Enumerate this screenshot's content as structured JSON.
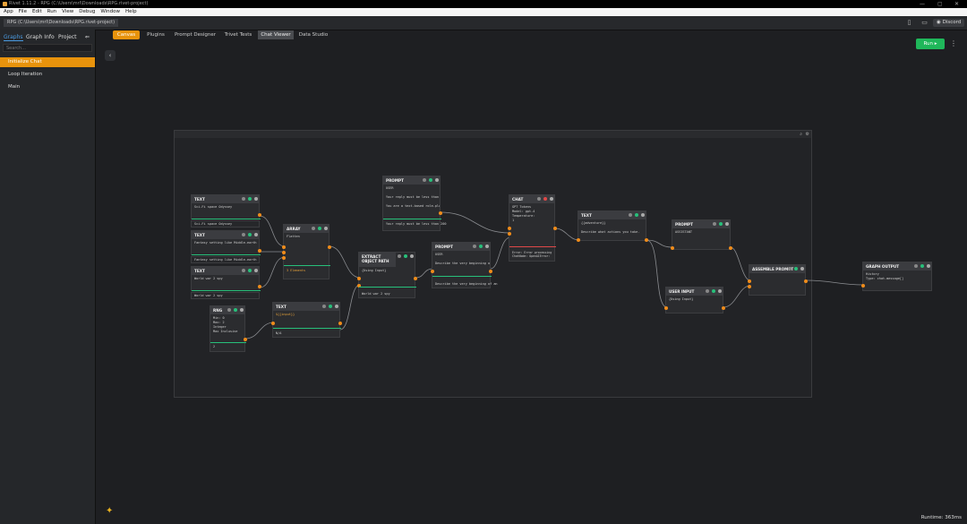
{
  "window": {
    "title": "Rivet 1.11.2 - RPG (C:\\Users\\mrl\\Downloads\\RPG.rivet-project)"
  },
  "menu": [
    "App",
    "File",
    "Edit",
    "Run",
    "View",
    "Debug",
    "Window",
    "Help"
  ],
  "project_tab": "RPG (C:\\Users\\mrl\\Downloads\\RPG.rivet-project)",
  "discord_label": "Discord",
  "sidebar": {
    "tabs": [
      "Graphs",
      "Graph Info",
      "Project"
    ],
    "search_placeholder": "Search...",
    "graphs": [
      "Initialize Chat",
      "Loop Iteration",
      "Main"
    ]
  },
  "top_tabs": [
    "Canvas",
    "Plugins",
    "Prompt Designer",
    "Trivet Tests",
    "Chat Viewer",
    "Data Studio"
  ],
  "run_label": "Run",
  "runtime": "Runtime: 363ms",
  "nodes": [
    {
      "title": "TEXT",
      "body": "Sci-Fi space Odyssey"
    },
    {
      "title": "TEXT",
      "body": "Fantasy setting like Middle-earth"
    },
    {
      "title": "TEXT",
      "body": "World war 2 spy"
    },
    {
      "title": "ARRAY",
      "body": "Flatten"
    },
    {
      "title": "RNG",
      "body": "Min: 0\nMax: 2\nInteger\nMax Inclusive"
    },
    {
      "title": "TEXT",
      "body": "${{input}}"
    },
    {
      "title": "PROMPT",
      "body": "USER\n\nYour reply must be less than 200 w\n\nYou are a text-based role-playing"
    },
    {
      "title": "EXTRACT OBJECT PATH",
      "body": "{Using Input}"
    },
    {
      "title": "PROMPT",
      "body": "USER\n\nDescribe the very beginning of an"
    },
    {
      "title": "CHAT",
      "body": "GPT Tokens\nModel: gpt-4\nTemperature:\n1"
    },
    {
      "title": "TEXT",
      "body": "{{adventure}}\n\nDescribe what actions you take."
    },
    {
      "title": "PROMPT",
      "body": "ASSISTANT"
    },
    {
      "title": "USER INPUT",
      "body": "{Using Input}"
    },
    {
      "title": "ASSEMBLE PROMPT",
      "body": ""
    },
    {
      "title": "GRAPH OUTPUT",
      "body": "History\nType: chat-message[]"
    }
  ],
  "chat_error": "Error: Error processing\nChatNode: OpenAIError:",
  "output_values": {
    "text1": "Sci-Fi space Odyssey",
    "text2": "Fantasy setting like Middle-earth",
    "text3": "World war 2 spy",
    "array": "3 Elements",
    "rng": "2",
    "text_input": "N/A",
    "extract": "World war 2 spy",
    "prompt1": "Your reply must be less than 200",
    "prompt2": "Describe the very beginning of an"
  },
  "colors": {
    "accent": "#e8930c",
    "run": "#1fb75a",
    "port": "#f08c1a",
    "wire": "#8a8c90",
    "tab_active": "#4a9ae0"
  }
}
